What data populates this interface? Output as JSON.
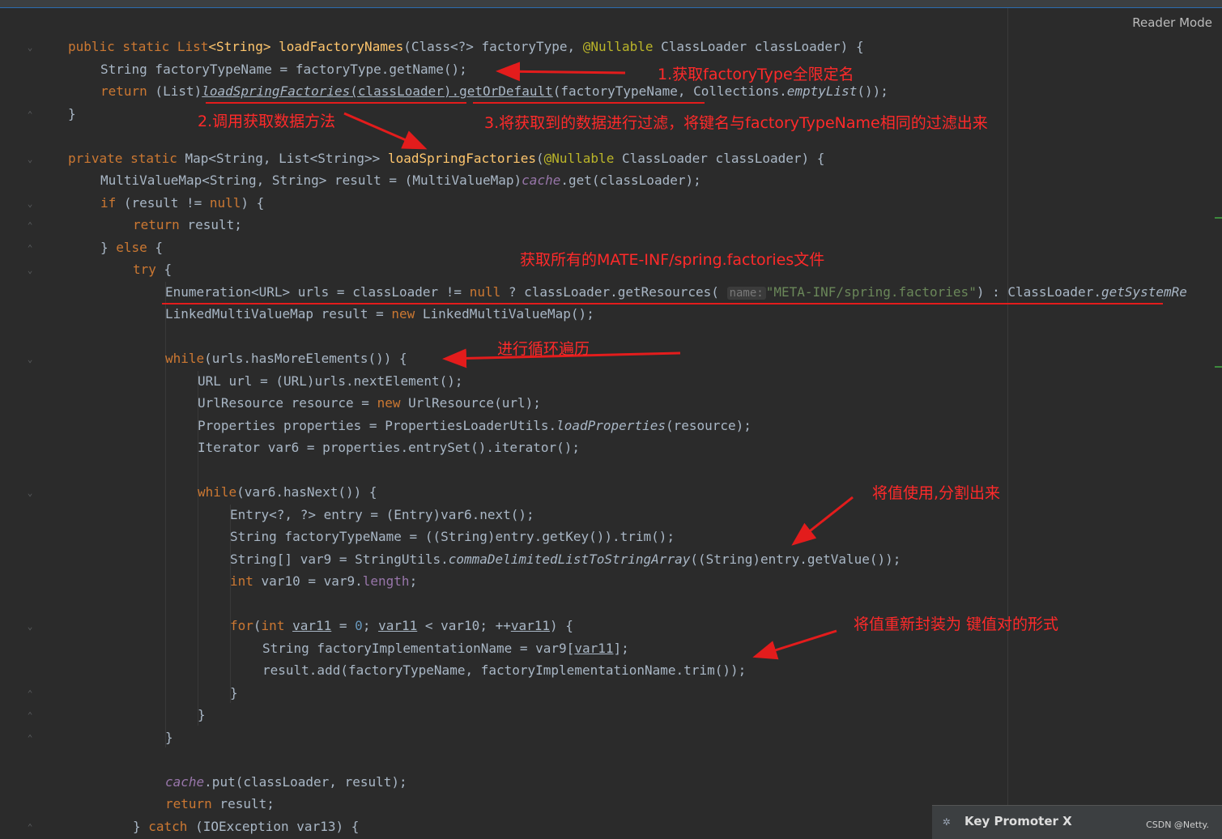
{
  "editor": {
    "reader_mode": "Reader Mode",
    "hint_name": "name:"
  },
  "code": {
    "l1a": "public static List",
    "l1b": "<String>",
    "l1c": " ",
    "l1d": "loadFactoryNames",
    "l1e": "(Class<?> factoryType, ",
    "l1f": "@Nullable",
    "l1g": " ClassLoader classLoader) {",
    "l2": "String factoryTypeName = factoryType.getName();",
    "l3a": "return",
    "l3b": " (List)",
    "l3c": "loadSpringFactories",
    "l3d": "(classLoader).",
    "l3e": "getOrDefault",
    "l3f": "(factoryTypeName, Collections.",
    "l3g": "emptyList",
    "l3h": "());",
    "l4": "}",
    "l5a": "private static",
    "l5b": " Map<String, List<String>> ",
    "l5c": "loadSpringFactories",
    "l5d": "(",
    "l5e": "@Nullable",
    "l5f": " ClassLoader classLoader) {",
    "l6a": "MultiValueMap<String, String> result = (MultiValueMap)",
    "l6b": "cache",
    "l6c": ".get(classLoader);",
    "l7a": "if",
    "l7b": " (result != ",
    "l7c": "null",
    "l7d": ") {",
    "l8a": "return",
    "l8b": " result;",
    "l9a": "} ",
    "l9b": "else",
    "l9c": " {",
    "l10a": "try",
    "l10b": " {",
    "l11a": "Enumeration<URL> urls = classLoader != ",
    "l11b": "null",
    "l11c": " ? classLoader.getResources( ",
    "l11d": "\"META-INF/spring.factories\"",
    "l11e": ") : ClassLoader.",
    "l11f": "getSystemRe",
    "l12a": "LinkedMultiValueMap result = ",
    "l12b": "new",
    "l12c": " LinkedMultiValueMap();",
    "l13a": "while",
    "l13b": "(urls.hasMoreElements()) {",
    "l14": "URL url = (URL)urls.nextElement();",
    "l15a": "UrlResource resource = ",
    "l15b": "new",
    "l15c": " UrlResource(url);",
    "l16a": "Properties properties = PropertiesLoaderUtils.",
    "l16b": "loadProperties",
    "l16c": "(resource);",
    "l17": "Iterator var6 = properties.entrySet().iterator();",
    "l18a": "while",
    "l18b": "(var6.hasNext()) {",
    "l19": "Entry<?, ?> entry = (Entry)var6.next();",
    "l20": "String factoryTypeName = ((String)entry.getKey()).trim();",
    "l21a": "String[] var9 = StringUtils.",
    "l21b": "commaDelimitedListToStringArray",
    "l21c": "((String)entry.getValue());",
    "l22a": "int",
    "l22b": " var10 = var9.",
    "l22c": "length",
    "l22d": ";",
    "l23a": "for",
    "l23b": "(",
    "l23c": "int",
    "l23d": " ",
    "l23e": "var11",
    "l23f": " = ",
    "l23g": "0",
    "l23h": "; ",
    "l23i": "var11",
    "l23j": " < var10; ++",
    "l23k": "var11",
    "l23l": ") {",
    "l24a": "String factoryImplementationName = var9[",
    "l24b": "var11",
    "l24c": "];",
    "l25": "result.add(factoryTypeName, factoryImplementationName.trim());",
    "l26": "}",
    "l27": "}",
    "l28": "}",
    "l29a": "cache",
    "l29b": ".put(classLoader, result);",
    "l30a": "return",
    "l30b": " result;",
    "l31a": "} ",
    "l31b": "catch",
    "l31c": " (IOException var13) {"
  },
  "annotations": {
    "n1": "1.获取factoryType全限定名",
    "n2": "2.调用获取数据方法",
    "n3": "3.将获取到的数据进行过滤，将键名与factoryTypeName相同的过滤出来",
    "n4": "获取所有的MATE-INF/spring.factories文件",
    "n5": "进行循环遍历",
    "n6": "将值使用,分割出来",
    "n7": "将值重新封装为 键值对的形式"
  },
  "popup": {
    "title": "Key Promoter X",
    "credit": "CSDN @Netty."
  },
  "colors": {
    "background": "#2b2b2b",
    "keyword": "#cc7832",
    "function": "#ffc66d",
    "annotation": "#bbb529",
    "string": "#6a8759",
    "field": "#9876aa",
    "number": "#6897bb",
    "note_red": "#ff2a2a"
  }
}
